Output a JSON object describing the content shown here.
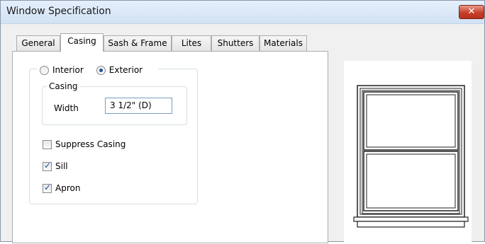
{
  "window": {
    "title": "Window Specification",
    "close_glyph": "✕"
  },
  "tabs": [
    {
      "label": "General"
    },
    {
      "label": "Casing",
      "active": true
    },
    {
      "label": "Sash & Frame"
    },
    {
      "label": "Lites"
    },
    {
      "label": "Shutters"
    },
    {
      "label": "Materials"
    }
  ],
  "casing_panel": {
    "side_options": [
      {
        "label": "Interior",
        "selected": false
      },
      {
        "label": "Exterior",
        "selected": true
      }
    ],
    "casing_group_label": "Casing",
    "width_label": "Width",
    "width_value": "3 1/2\" (D)",
    "checkboxes": [
      {
        "label": "Suppress Casing",
        "checked": false
      },
      {
        "label": "Sill",
        "checked": true
      },
      {
        "label": "Apron",
        "checked": true
      }
    ]
  },
  "colors": {
    "accent": "#1c4f9c",
    "close_button": "#c73f2a"
  },
  "icons": {
    "close": "close-icon",
    "preview": "double-hung-window-preview"
  }
}
